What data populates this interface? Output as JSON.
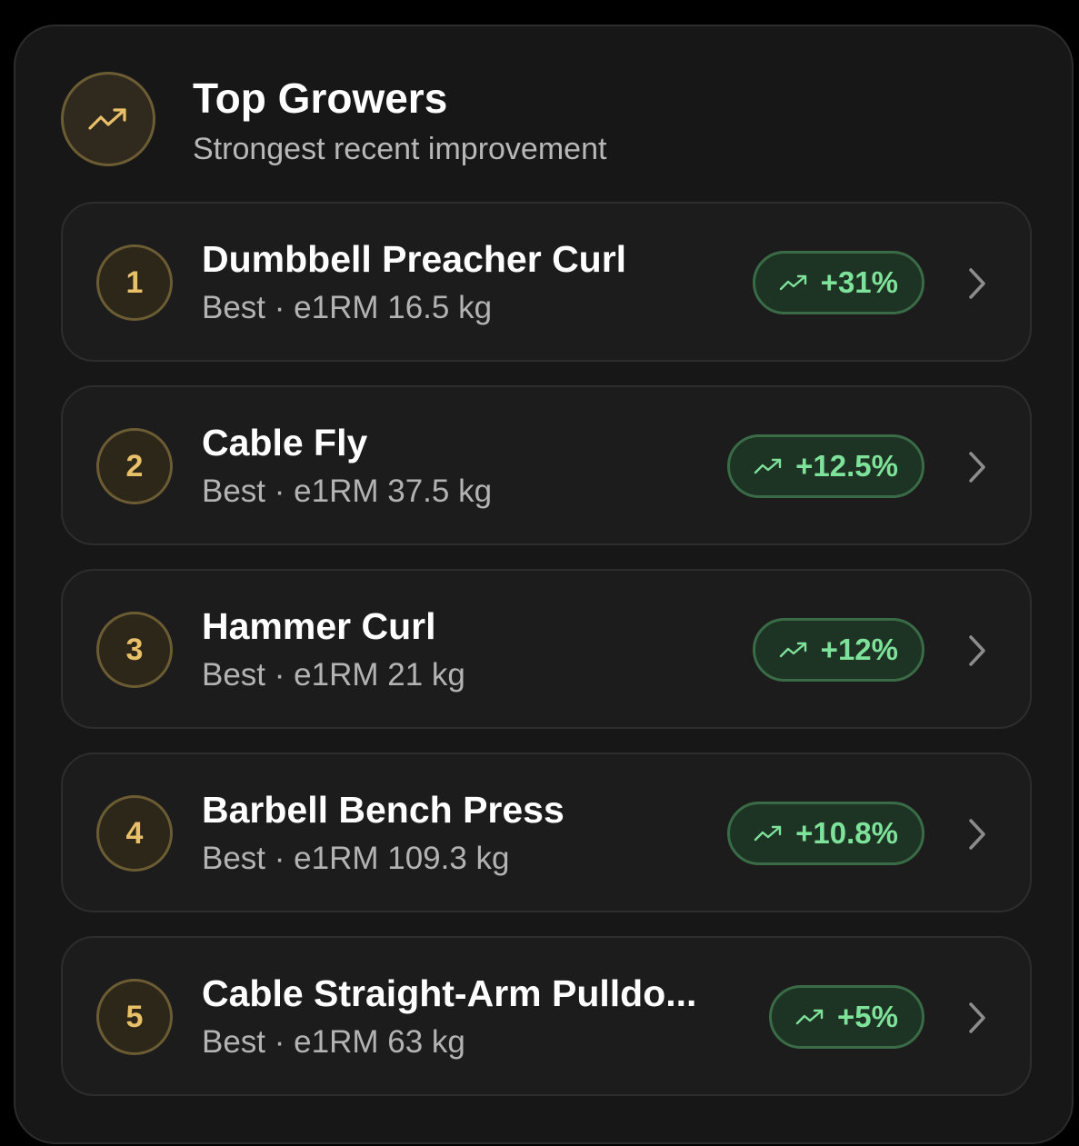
{
  "header": {
    "icon": "trending-up-icon",
    "title": "Top Growers",
    "subtitle": "Strongest recent improvement"
  },
  "colors": {
    "accent_gold": "#e9c06a",
    "positive_green": "#7ee29a",
    "card_bg": "#171717"
  },
  "rows": [
    {
      "rank": "1",
      "name": "Dumbbell Preacher Curl",
      "best": "Best · e1RM 16.5 kg",
      "change": "+31%"
    },
    {
      "rank": "2",
      "name": "Cable Fly",
      "best": "Best · e1RM 37.5 kg",
      "change": "+12.5%"
    },
    {
      "rank": "3",
      "name": "Hammer Curl",
      "best": "Best · e1RM 21 kg",
      "change": "+12%"
    },
    {
      "rank": "4",
      "name": "Barbell Bench Press",
      "best": "Best · e1RM 109.3 kg",
      "change": "+10.8%"
    },
    {
      "rank": "5",
      "name": "Cable Straight-Arm Pulldo...",
      "best": "Best · e1RM 63 kg",
      "change": "+5%"
    }
  ]
}
